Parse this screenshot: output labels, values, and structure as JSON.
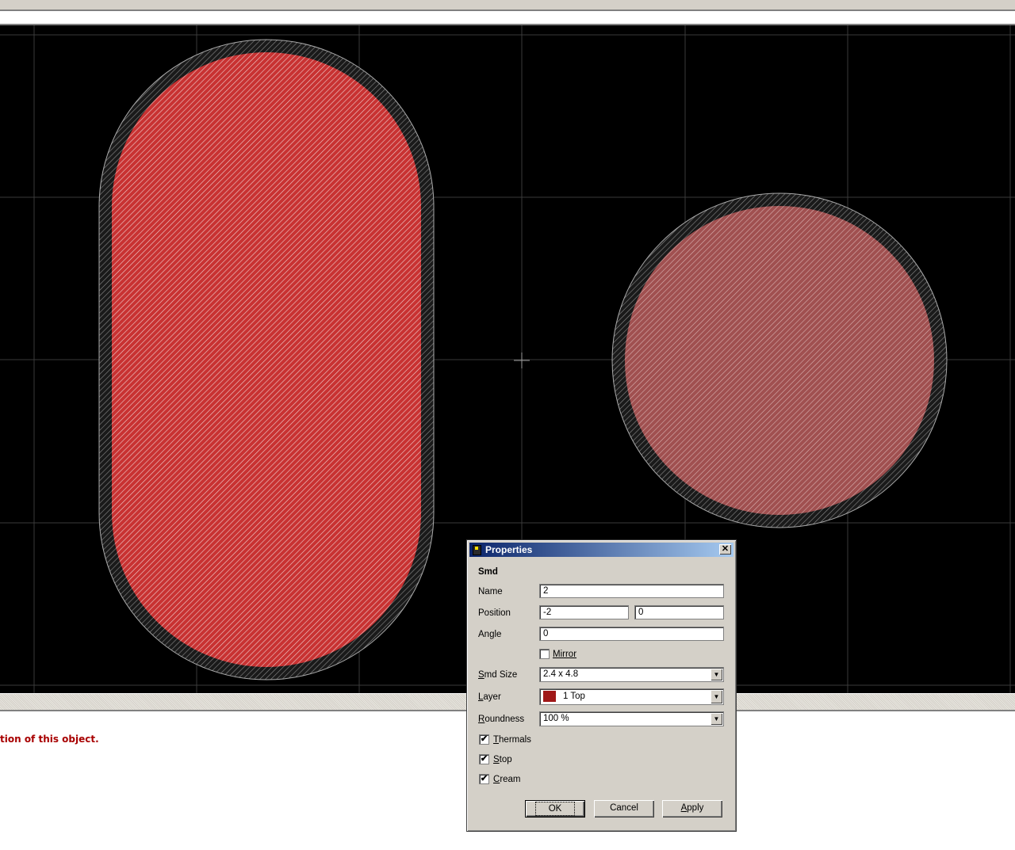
{
  "status": {
    "message": "tion of this object."
  },
  "canvas": {
    "background": "#000000",
    "grid_color": "#3a3a3a",
    "pad_color": "#c83232",
    "pad_selected_color": "#e65a5a"
  },
  "dialog": {
    "title": "Properties",
    "close_label": "✕",
    "section": "Smd",
    "name_label": "Name",
    "name_value": "2",
    "position_label": "Position",
    "position_x": "-2",
    "position_y": "0",
    "angle_label": "Angle",
    "angle_value": "0",
    "mirror_label": "Mirror",
    "mirror_checked": false,
    "smd_size_label_prefix": "S",
    "smd_size_label_rest": "md Size",
    "smd_size_value": "2.4 x 4.8",
    "layer_label_prefix": "L",
    "layer_label_rest": "ayer",
    "layer_value": "1 Top",
    "layer_color": "#a01818",
    "roundness_label_prefix": "R",
    "roundness_label_rest": "oundness",
    "roundness_value": "100 %",
    "thermals_label_prefix": "T",
    "thermals_label_rest": "hermals",
    "thermals_checked": true,
    "stop_label_prefix": "S",
    "stop_label_rest": "top",
    "stop_checked": true,
    "cream_label_prefix": "C",
    "cream_label_rest": "ream",
    "cream_checked": true,
    "ok_label": "OK",
    "cancel_label": "Cancel",
    "apply_label_prefix": "A",
    "apply_label_rest": "pply",
    "check_mark": "✔"
  }
}
